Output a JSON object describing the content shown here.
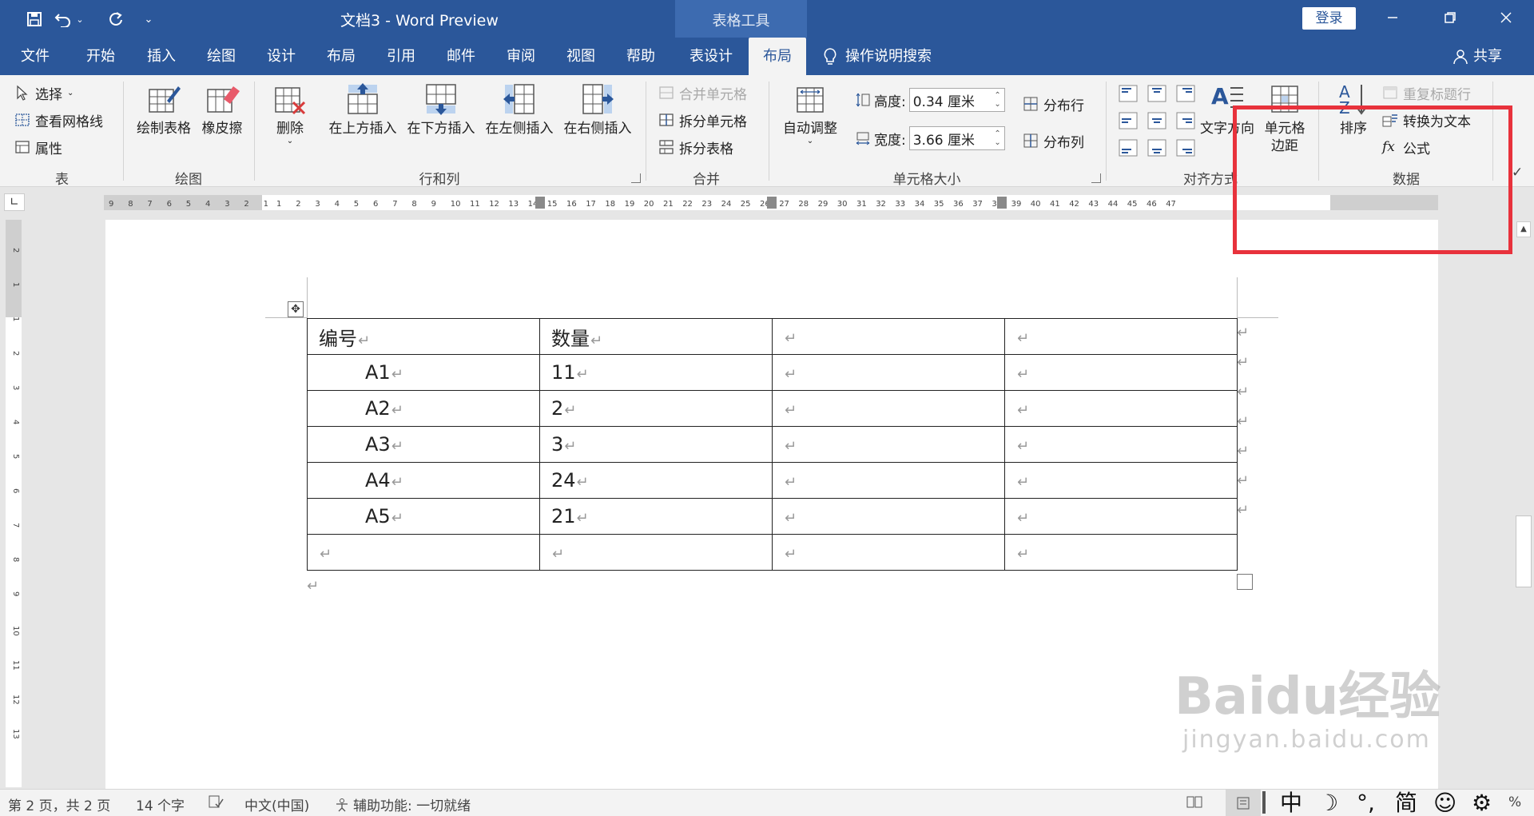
{
  "title_bar": {
    "doc_title": "文档3  -  Word Preview",
    "context_label": "表格工具",
    "login": "登录"
  },
  "tabs": [
    "文件",
    "开始",
    "插入",
    "绘图",
    "设计",
    "布局",
    "引用",
    "邮件",
    "审阅",
    "视图",
    "帮助",
    "表设计",
    "布局"
  ],
  "active_tab": "布局",
  "search_tell": "操作说明搜索",
  "share": "共享",
  "ribbon": {
    "table_group": {
      "label": "表",
      "select": "选择",
      "view_gridlines": "查看网格线",
      "properties": "属性"
    },
    "draw_group": {
      "label": "绘图",
      "draw_table": "绘制表格",
      "eraser": "橡皮擦"
    },
    "rows_cols_group": {
      "label": "行和列",
      "delete": "删除",
      "insert_above": "在上方插入",
      "insert_below": "在下方插入",
      "insert_left": "在左侧插入",
      "insert_right": "在右侧插入"
    },
    "merge_group": {
      "label": "合并",
      "merge_cells": "合并单元格",
      "split_cells": "拆分单元格",
      "split_table": "拆分表格"
    },
    "cell_size_group": {
      "label": "单元格大小",
      "autofit": "自动调整",
      "height_label": "高度:",
      "height_value": "0.34 厘米",
      "width_label": "宽度:",
      "width_value": "3.66 厘米",
      "distribute_rows": "分布行",
      "distribute_cols": "分布列"
    },
    "alignment_group": {
      "label": "对齐方式",
      "text_direction": "文字方向",
      "cell_margins_line1": "单元格",
      "cell_margins_line2": "边距"
    },
    "data_group": {
      "label": "数据",
      "sort": "排序",
      "repeat_header": "重复标题行",
      "convert_to_text": "转换为文本",
      "formula": "公式"
    }
  },
  "ruler_left_numbers": [
    "9",
    "8",
    "7",
    "6",
    "5",
    "4",
    "3",
    "2",
    "1"
  ],
  "ruler_right_numbers": [
    "1",
    "2",
    "3",
    "4",
    "5",
    "6",
    "7",
    "8",
    "9",
    "10",
    "11",
    "12",
    "13",
    "14",
    "15",
    "16",
    "17",
    "18",
    "19",
    "20",
    "21",
    "22",
    "23",
    "24",
    "25",
    "26",
    "27",
    "28",
    "29",
    "30",
    "31",
    "32",
    "33",
    "34",
    "35",
    "36",
    "37",
    "38",
    "39",
    "40",
    "41",
    "42",
    "43",
    "44",
    "45",
    "46",
    "47"
  ],
  "vruler_numbers": [
    "2",
    "1",
    "1",
    "2",
    "3",
    "4",
    "5",
    "6",
    "7",
    "8",
    "9",
    "10",
    "11",
    "12",
    "13"
  ],
  "table": {
    "rows": [
      [
        "编号",
        "数量",
        "",
        ""
      ],
      [
        "A1",
        "11",
        "",
        ""
      ],
      [
        "A2",
        "2",
        "",
        ""
      ],
      [
        "A3",
        "3",
        "",
        ""
      ],
      [
        "A4",
        "24",
        "",
        ""
      ],
      [
        "A5",
        "21",
        "",
        ""
      ],
      [
        "",
        "",
        "",
        ""
      ]
    ],
    "paragraph_mark": "↵"
  },
  "status_bar": {
    "page": "第 2 页，共 2 页",
    "words": "14 个字",
    "language": "中文(中国)",
    "accessibility": "辅助功能: 一切就绪",
    "ime": [
      "中",
      "☽",
      "°,",
      "简",
      "☺",
      "⚙"
    ],
    "zoom": "%"
  },
  "watermark": {
    "main": "Baidu经验",
    "sub": "jingyan.baidu.com"
  },
  "colors": {
    "brand": "#2b579a",
    "highlight": "#e8323c"
  }
}
